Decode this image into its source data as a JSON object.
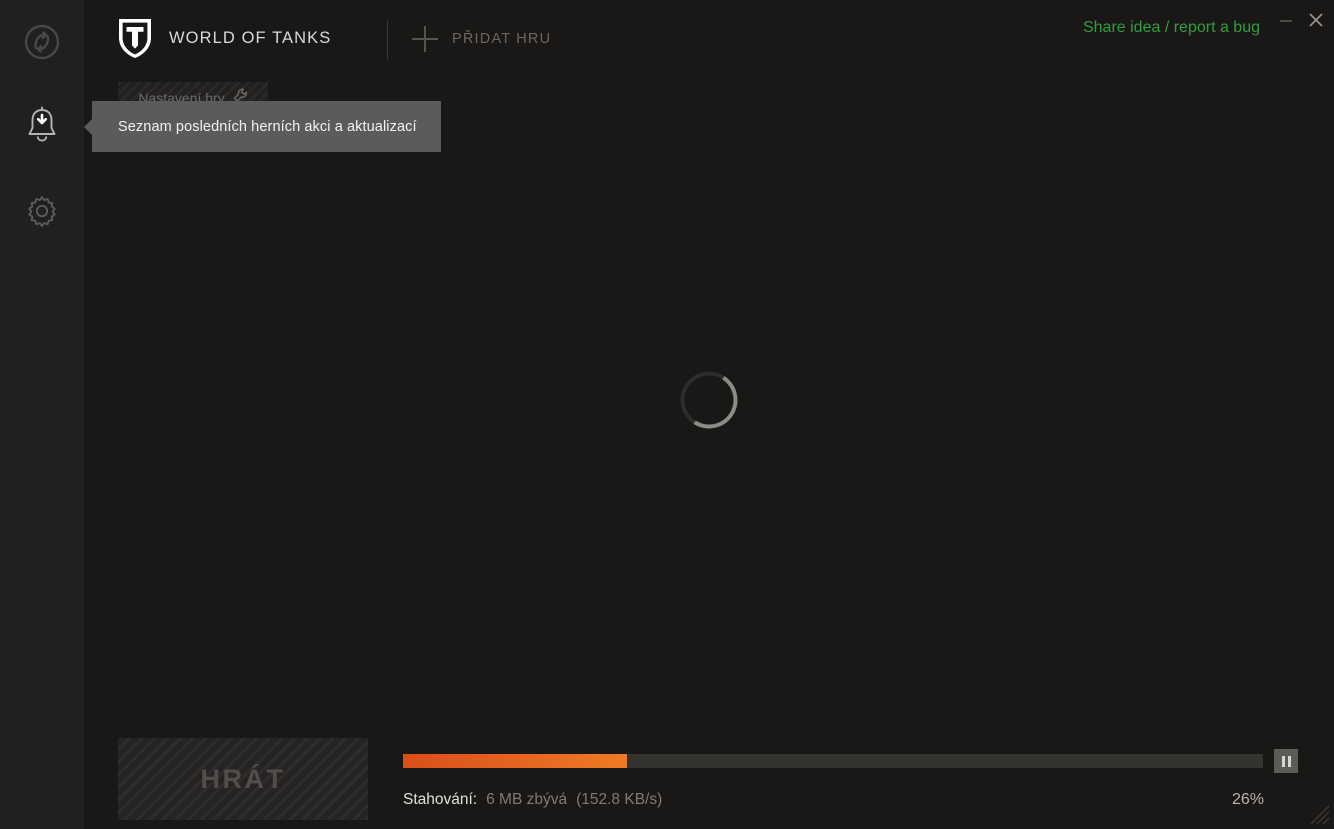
{
  "window": {
    "minimize_label": "—",
    "close_label": "×"
  },
  "sidebar": {
    "items": [
      {
        "name": "wargaming-center-icon",
        "label": "Wargaming Game Center"
      },
      {
        "name": "notifications-icon",
        "label": "Notifications / Downloads"
      },
      {
        "name": "settings-gear-icon",
        "label": "Settings"
      }
    ]
  },
  "header": {
    "game_tab": {
      "logo": "world-of-tanks-shield-icon",
      "title": "WORLD OF TANKS"
    },
    "add_game": {
      "icon": "plus-icon",
      "label": "PŘIDAT HRU"
    },
    "report_link": "Share idea / report a bug"
  },
  "game_settings": {
    "label": "Nastavení hry",
    "icon": "wrench-icon"
  },
  "tooltip": {
    "text": "Seznam posledních herních akci a aktualizací"
  },
  "content": {
    "state": "loading",
    "spinner": "loading-spinner"
  },
  "bottom_bar": {
    "play_label": "HRÁT",
    "download": {
      "label": "Stahování:",
      "remaining": "6 MB zbývá",
      "speed": "(152.8 KB/s)",
      "percent_label": "26%",
      "percent_value": 26
    },
    "pause_button": "pause-icon"
  },
  "colors": {
    "accent_orange": "#ef7a25",
    "accent_orange_dark": "#d94f1a",
    "link_green": "#2f9e3f",
    "app_background": "#1a1817",
    "rail_background": "#202020",
    "tooltip_background": "#5b5b5b"
  }
}
